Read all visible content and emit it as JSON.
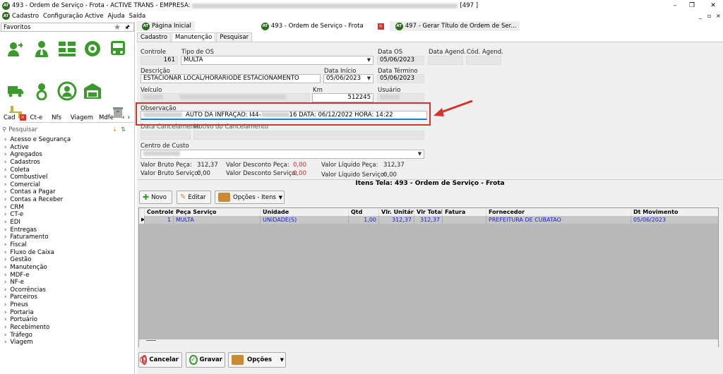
{
  "window": {
    "title_left": "493 - Ordem de Serviço - Frota - ACTIVE TRANS - EMPRESA:",
    "title_right": "[497 ]",
    "logo_text": "AT",
    "controls": {
      "minimize": "–",
      "restore": "❐",
      "close": "✕"
    }
  },
  "menubar": {
    "items": [
      "Cadastro",
      "Configuração Active",
      "Ajuda",
      "Saída"
    ],
    "right_controls": [
      "_",
      "▫",
      "×"
    ]
  },
  "sidebar": {
    "favorites_label": "Favoritos",
    "tabs": [
      {
        "label": "Cad"
      },
      {
        "label": "Ct-e"
      },
      {
        "label": "Nfs"
      },
      {
        "label": "Viagem"
      },
      {
        "label": "Mdfe"
      }
    ],
    "search_placeholder": "Pesquisar",
    "tree": [
      "Acesso e Segurança",
      "Active",
      "Agregados",
      "Cadastros",
      "Coleta",
      "Combustivel",
      "Comercial",
      "Contas a Pagar",
      "Contas a Receber",
      "CRM",
      "CT-e",
      "EDI",
      "Entregas",
      "Faturamento",
      "Fiscal",
      "Fluxo de Caixa",
      "Gestão",
      "Manutenção",
      "MDF-e",
      "NF-e",
      "Ocorrências",
      "Parceiros",
      "Pneus",
      "Portaria",
      "Portuário",
      "Recebimento",
      "Tráfego",
      "Viagem"
    ]
  },
  "main_tabs": [
    {
      "label": "Página Inicial"
    },
    {
      "label": "493 - Ordem de Serviço - Frota"
    },
    {
      "label": "497 - Gerar Título de Ordem de Ser..."
    }
  ],
  "sub_tabs": [
    "Cadastro",
    "Manutenção",
    "Pesquisar"
  ],
  "form": {
    "controle": {
      "label": "Controle",
      "value": "161"
    },
    "tipo_os": {
      "label": "Tipo de OS",
      "value": "MULTA"
    },
    "data_os": {
      "label": "Data OS",
      "value": "05/06/2023"
    },
    "data_agend": {
      "label": "Data Agend."
    },
    "cod_agend": {
      "label": "Cód. Agend."
    },
    "descricao": {
      "label": "Descrição",
      "value": "ESTACIONAR LOCAL/HORARIODE ESTACIONAMENTO"
    },
    "data_inicio": {
      "label": "Data Início",
      "value": "05/06/2023"
    },
    "data_termino": {
      "label": "Data Término",
      "value": "05/06/2023"
    },
    "veiculo": {
      "label": "Veículo"
    },
    "km": {
      "label": "Km",
      "value": "512245"
    },
    "usuario": {
      "label": "Usuário"
    },
    "observacao": {
      "label": "Observação",
      "value_a": "AUTO DA INFRAÇÃO: I44-",
      "value_b": "16 DATA: 06/12/2022 HORA: 14:22"
    },
    "data_cancel": {
      "label": "Data Cancelamento"
    },
    "motivo_cancel": {
      "label": "Motivo do Cancelamento"
    },
    "centro_custo": {
      "label": "Centro de Custo"
    },
    "totals": {
      "bruto_peca": {
        "label": "Valor Bruto Peça:",
        "value": "312,37"
      },
      "desc_peca": {
        "label": "Valor Desconto Peça:",
        "value": "0,00"
      },
      "liq_peca": {
        "label": "Valor Líquido Peça:",
        "value": "312,37"
      },
      "bruto_serv": {
        "label": "Valor Bruto Serviço:",
        "value": "0,00"
      },
      "desc_serv": {
        "label": "Valor Desconto Serviço:",
        "value": "0,00"
      },
      "liq_serv": {
        "label": "Valor Líquido Serviço:",
        "value": "0,00"
      }
    }
  },
  "items": {
    "title": "Itens Tela:  493 - Ordem de Serviço - Frota",
    "buttons": {
      "novo": "Novo",
      "editar": "Editar",
      "opcoes_itens": "Opções - Itens"
    },
    "columns": [
      "Controle",
      "Peça Serviço",
      "Unidade",
      "Qtd",
      "Vlr. Unitário",
      "Vlr Total",
      "Fatura",
      "Fornecedor",
      "Dt Movimento"
    ],
    "rows": [
      {
        "controle": "1",
        "peca": "MULTA",
        "unidade": "UNIDADE(S)",
        "qtd": "1,00",
        "unit": "312,37",
        "total": "312,37",
        "fatura": "",
        "fornecedor": "PREFEITURA DE CUBATAO",
        "dt": "05/06/2023"
      }
    ]
  },
  "footer_buttons": {
    "cancelar": "Cancelar",
    "gravar": "Gravar",
    "opcoes": "Opções"
  },
  "colors": {
    "accent_red": "#d9322b",
    "logo_green": "#2e6b1e",
    "icon_green": "#3a9a2c",
    "grid_text": "#1c23c0"
  }
}
